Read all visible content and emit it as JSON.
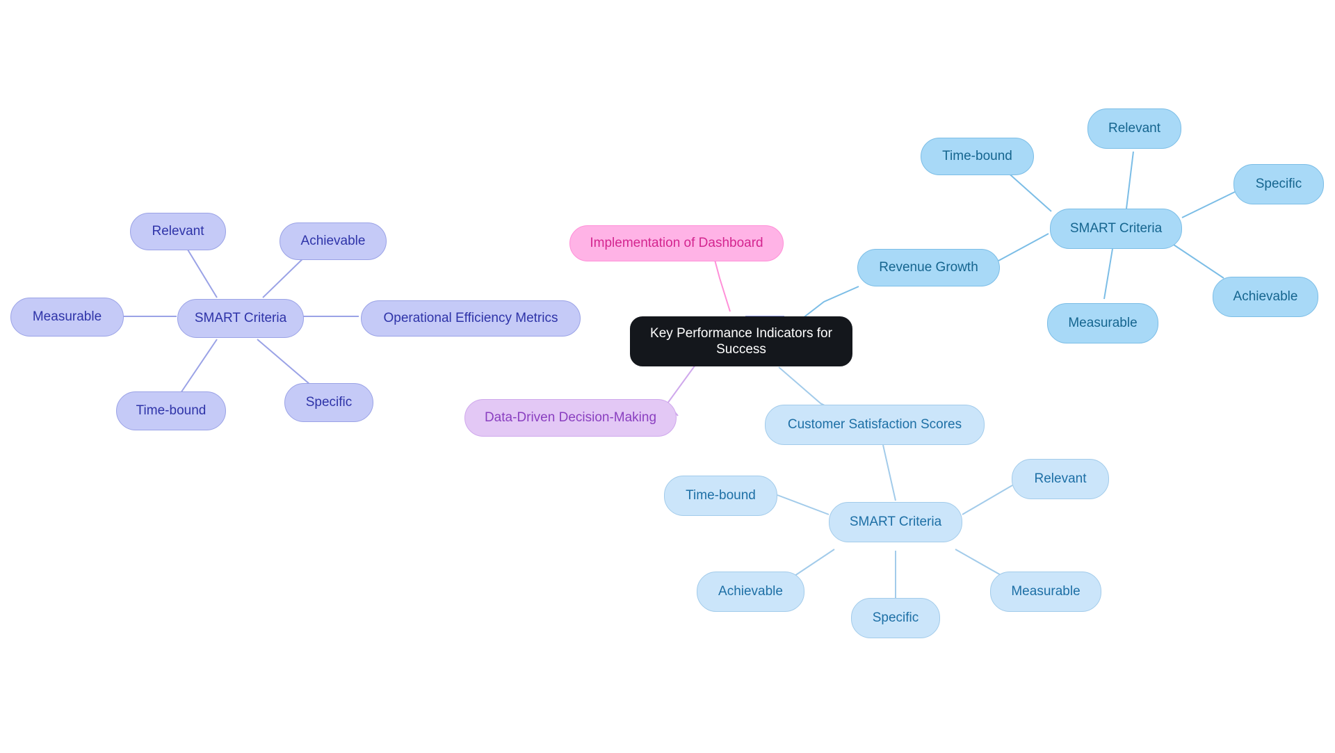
{
  "diagram": {
    "type": "mindmap",
    "title": "Key Performance Indicators for Success",
    "background": "#ffffff",
    "palette": {
      "root_fill": "#14171c",
      "root_text": "#ffffff",
      "indigo_fill": "#c5caf7",
      "indigo_text": "#2e33a8",
      "violet_fill": "#e3c8f5",
      "violet_text": "#8a3fc0",
      "pink_fill": "#ffb3e6",
      "pink_text": "#d4258f",
      "blue_fill": "#a8d9f7",
      "blue_text": "#15658f",
      "blue_light_fill": "#cbe5fa",
      "blue_light_text": "#1d6fa5"
    },
    "nodes": {
      "root": "Key Performance Indicators for\nSuccess",
      "branch_operational": "Operational Efficiency Metrics",
      "branch_dashboard": "Implementation of Dashboard",
      "branch_datadriven": "Data-Driven Decision-Making",
      "branch_revenue": "Revenue Growth",
      "branch_customer": "Customer Satisfaction Scores",
      "smart_left": "SMART Criteria",
      "smart_topright": "SMART Criteria",
      "smart_bottom": "SMART Criteria",
      "left_relevant": "Relevant",
      "left_achievable": "Achievable",
      "left_measurable": "Measurable",
      "left_timebound": "Time-bound",
      "left_specific": "Specific",
      "tr_timebound": "Time-bound",
      "tr_relevant": "Relevant",
      "tr_specific": "Specific",
      "tr_achievable": "Achievable",
      "tr_measurable": "Measurable",
      "bot_timebound": "Time-bound",
      "bot_relevant": "Relevant",
      "bot_achievable": "Achievable",
      "bot_specific": "Specific",
      "bot_measurable": "Measurable"
    },
    "edges": [
      {
        "from": "root",
        "to": "branch_operational",
        "color": "#9aa2e6"
      },
      {
        "from": "root",
        "to": "branch_dashboard",
        "color": "#ff8fd8"
      },
      {
        "from": "root",
        "to": "branch_datadriven",
        "color": "#cfa8ec"
      },
      {
        "from": "root",
        "to": "branch_revenue",
        "color": "#7bbde6"
      },
      {
        "from": "root",
        "to": "branch_customer",
        "color": "#a2cbea"
      },
      {
        "from": "branch_operational",
        "to": "smart_left",
        "color": "#9aa2e6"
      },
      {
        "from": "smart_left",
        "to": "left_relevant",
        "color": "#9aa2e6"
      },
      {
        "from": "smart_left",
        "to": "left_achievable",
        "color": "#9aa2e6"
      },
      {
        "from": "smart_left",
        "to": "left_measurable",
        "color": "#9aa2e6"
      },
      {
        "from": "smart_left",
        "to": "left_timebound",
        "color": "#9aa2e6"
      },
      {
        "from": "smart_left",
        "to": "left_specific",
        "color": "#9aa2e6"
      },
      {
        "from": "branch_revenue",
        "to": "smart_topright",
        "color": "#7bbde6"
      },
      {
        "from": "smart_topright",
        "to": "tr_timebound",
        "color": "#7bbde6"
      },
      {
        "from": "smart_topright",
        "to": "tr_relevant",
        "color": "#7bbde6"
      },
      {
        "from": "smart_topright",
        "to": "tr_specific",
        "color": "#7bbde6"
      },
      {
        "from": "smart_topright",
        "to": "tr_achievable",
        "color": "#7bbde6"
      },
      {
        "from": "smart_topright",
        "to": "tr_measurable",
        "color": "#7bbde6"
      },
      {
        "from": "branch_customer",
        "to": "smart_bottom",
        "color": "#a2cbea"
      },
      {
        "from": "smart_bottom",
        "to": "bot_timebound",
        "color": "#a2cbea"
      },
      {
        "from": "smart_bottom",
        "to": "bot_relevant",
        "color": "#a2cbea"
      },
      {
        "from": "smart_bottom",
        "to": "bot_achievable",
        "color": "#a2cbea"
      },
      {
        "from": "smart_bottom",
        "to": "bot_specific",
        "color": "#a2cbea"
      },
      {
        "from": "smart_bottom",
        "to": "bot_measurable",
        "color": "#a2cbea"
      }
    ]
  }
}
